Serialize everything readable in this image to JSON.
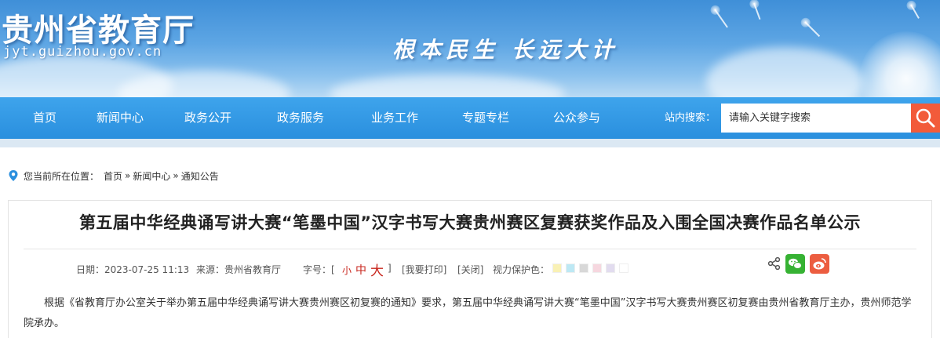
{
  "header": {
    "site_title": "贵州省教育厅",
    "site_domain": "jyt.guizhou.gov.cn",
    "slogan": "根本民生 长远大计"
  },
  "nav": {
    "items": [
      {
        "label": "首页"
      },
      {
        "label": "新闻中心"
      },
      {
        "label": "政务公开"
      },
      {
        "label": "政务服务"
      },
      {
        "label": "业务工作"
      },
      {
        "label": "专题专栏"
      },
      {
        "label": "公众参与"
      }
    ],
    "search_label": "站内搜索：",
    "search_placeholder": "请输入关键字搜索",
    "search_icon": "search-icon"
  },
  "breadcrumb": {
    "prefix": "您当前所在位置：",
    "items": [
      "首页",
      "新闻中心",
      "通知公告"
    ],
    "separator": "»",
    "icon": "location-pin-icon"
  },
  "article": {
    "title": "第五届中华经典诵写讲大赛“笔墨中国”汉字书写大赛贵州赛区复赛获奖作品及入围全国决赛作品名单公示",
    "date_label": "日期：2023-07-25 11:13",
    "source_label": "来源：贵州省教育厅",
    "font_size_label": "字号：[",
    "font_size_small": "小",
    "font_size_mid": "中",
    "font_size_big": "大",
    "font_size_close": "]",
    "print_label": "[我要打印]",
    "close_label": "[关闭]",
    "eye_care_label": "视力保护色：",
    "eye_care_colors": [
      "#f9f1b5",
      "#bde8f4",
      "#d8d8d8",
      "#f6d7df",
      "#e2dcef",
      "#ffffff"
    ],
    "paragraph": "根据《省教育厅办公室关于举办第五届中华经典诵写讲大赛贵州赛区初复赛的通知》要求，第五届中华经典诵写讲大赛“笔墨中国”汉字书写大赛贵州赛区初复赛由贵州省教育厅主办，贵州师范学院承办。"
  },
  "colors": {
    "nav_bg": "#2a8fde",
    "search_button": "#f25b3a",
    "accent_red": "#c8261e",
    "wechat": "#36b233",
    "weibo": "#ec5d40"
  }
}
